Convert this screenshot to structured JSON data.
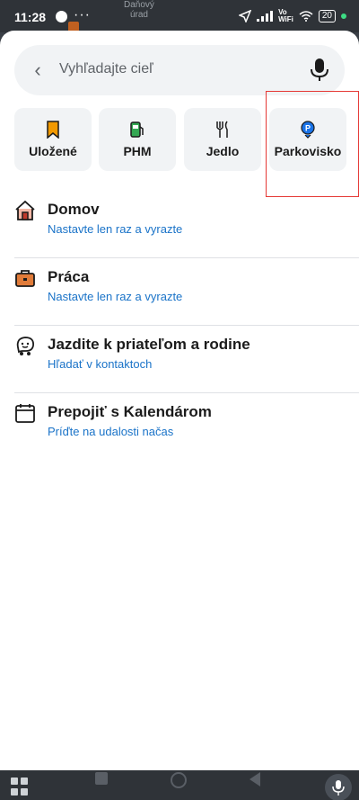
{
  "status": {
    "time": "11:28",
    "dots": "···",
    "map_label": "Daňový\núrad",
    "network_label": "Vo\nWiFi",
    "battery": "20"
  },
  "search": {
    "placeholder": "Vyhľadajte cieľ",
    "back_glyph": "‹"
  },
  "chips": [
    {
      "label": "Uložené",
      "icon": "bookmark-icon",
      "color": "#f29900"
    },
    {
      "label": "PHM",
      "icon": "fuel-pump-icon",
      "color": "#34a853"
    },
    {
      "label": "Jedlo",
      "icon": "cutlery-icon",
      "color": "#1b1b1b"
    },
    {
      "label": "Parkovisko",
      "icon": "parking-pin-icon",
      "color": "#1a73e8"
    }
  ],
  "items": [
    {
      "title": "Domov",
      "subtitle": "Nastavte len raz a vyrazte",
      "icon": "home-icon"
    },
    {
      "title": "Práca",
      "subtitle": "Nastavte len raz a vyrazte",
      "icon": "briefcase-icon"
    },
    {
      "title": "Jazdite k priateľom a rodine",
      "subtitle": "Hľadať v kontaktoch",
      "icon": "waze-icon"
    },
    {
      "title": "Prepojiť s Kalendárom",
      "subtitle": "Príďte na udalosti načas",
      "icon": "calendar-icon"
    }
  ],
  "colors": {
    "link": "#1a73c8",
    "chip_bg": "#f1f3f5",
    "highlight": "#e53935"
  }
}
